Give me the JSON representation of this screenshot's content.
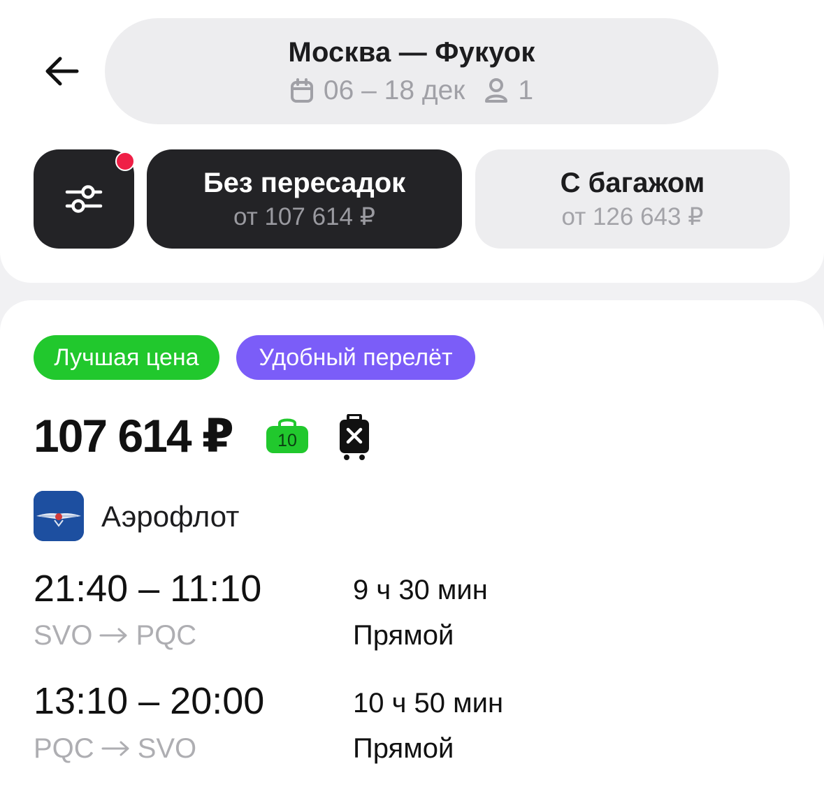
{
  "header": {
    "route_title": "Москва — Фукуок",
    "dates": "06 – 18 дек",
    "passengers": "1"
  },
  "filters": {
    "has_active_filters": true,
    "chips": [
      {
        "title": "Без пересадок",
        "price": "от 107 614 ₽",
        "selected": true
      },
      {
        "title": "С багажом",
        "price": "от 126 643 ₽",
        "selected": false
      }
    ]
  },
  "result": {
    "badges": [
      {
        "label": "Лучшая цена",
        "color": "#21c82d"
      },
      {
        "label": "Удобный перелёт",
        "color": "#7b5df8"
      }
    ],
    "price": "107 614 ₽",
    "hand_luggage_kg": "10",
    "baggage_included": false,
    "airline": "Аэрофлот",
    "segments": [
      {
        "times": "21:40 – 11:10",
        "from": "SVO",
        "to": "PQC",
        "duration": "9 ч 30 мин",
        "stops": "Прямой"
      },
      {
        "times": "13:10 – 20:00",
        "from": "PQC",
        "to": "SVO",
        "duration": "10 ч 50 мин",
        "stops": "Прямой"
      }
    ]
  },
  "icons": {
    "back": "arrow-left-icon",
    "calendar": "calendar-icon",
    "passenger": "person-icon",
    "filter": "sliders-icon",
    "hand_luggage": "hand-luggage-icon",
    "no_baggage": "no-baggage-icon",
    "airline_logo": "aeroflot-logo"
  }
}
